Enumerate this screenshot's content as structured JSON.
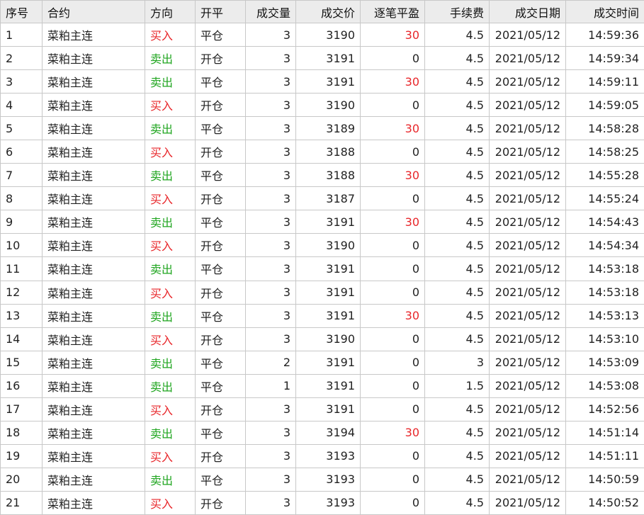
{
  "columns": [
    "序号",
    "合约",
    "方向",
    "开平",
    "成交量",
    "成交价",
    "逐笔平盈",
    "手续费",
    "成交日期",
    "成交时间"
  ],
  "colors": {
    "buy": "#e8262a",
    "sell": "#1fa51f",
    "profit": "#e8262a",
    "text": "#222222",
    "header_bg": "#ececec",
    "grid_line": "#c8c8c8"
  },
  "rows": [
    {
      "no": "1",
      "contract": "菜粕主连",
      "dir": "买入",
      "oc": "平仓",
      "vol": "3",
      "price": "3190",
      "pnl": "30",
      "fee": "4.5",
      "date": "2021/05/12",
      "time": "14:59:36"
    },
    {
      "no": "2",
      "contract": "菜粕主连",
      "dir": "卖出",
      "oc": "开仓",
      "vol": "3",
      "price": "3191",
      "pnl": "0",
      "fee": "4.5",
      "date": "2021/05/12",
      "time": "14:59:34"
    },
    {
      "no": "3",
      "contract": "菜粕主连",
      "dir": "卖出",
      "oc": "平仓",
      "vol": "3",
      "price": "3191",
      "pnl": "30",
      "fee": "4.5",
      "date": "2021/05/12",
      "time": "14:59:11"
    },
    {
      "no": "4",
      "contract": "菜粕主连",
      "dir": "买入",
      "oc": "开仓",
      "vol": "3",
      "price": "3190",
      "pnl": "0",
      "fee": "4.5",
      "date": "2021/05/12",
      "time": "14:59:05"
    },
    {
      "no": "5",
      "contract": "菜粕主连",
      "dir": "卖出",
      "oc": "平仓",
      "vol": "3",
      "price": "3189",
      "pnl": "30",
      "fee": "4.5",
      "date": "2021/05/12",
      "time": "14:58:28"
    },
    {
      "no": "6",
      "contract": "菜粕主连",
      "dir": "买入",
      "oc": "开仓",
      "vol": "3",
      "price": "3188",
      "pnl": "0",
      "fee": "4.5",
      "date": "2021/05/12",
      "time": "14:58:25"
    },
    {
      "no": "7",
      "contract": "菜粕主连",
      "dir": "卖出",
      "oc": "平仓",
      "vol": "3",
      "price": "3188",
      "pnl": "30",
      "fee": "4.5",
      "date": "2021/05/12",
      "time": "14:55:28"
    },
    {
      "no": "8",
      "contract": "菜粕主连",
      "dir": "买入",
      "oc": "开仓",
      "vol": "3",
      "price": "3187",
      "pnl": "0",
      "fee": "4.5",
      "date": "2021/05/12",
      "time": "14:55:24"
    },
    {
      "no": "9",
      "contract": "菜粕主连",
      "dir": "卖出",
      "oc": "平仓",
      "vol": "3",
      "price": "3191",
      "pnl": "30",
      "fee": "4.5",
      "date": "2021/05/12",
      "time": "14:54:43"
    },
    {
      "no": "10",
      "contract": "菜粕主连",
      "dir": "买入",
      "oc": "开仓",
      "vol": "3",
      "price": "3190",
      "pnl": "0",
      "fee": "4.5",
      "date": "2021/05/12",
      "time": "14:54:34"
    },
    {
      "no": "11",
      "contract": "菜粕主连",
      "dir": "卖出",
      "oc": "平仓",
      "vol": "3",
      "price": "3191",
      "pnl": "0",
      "fee": "4.5",
      "date": "2021/05/12",
      "time": "14:53:18"
    },
    {
      "no": "12",
      "contract": "菜粕主连",
      "dir": "买入",
      "oc": "开仓",
      "vol": "3",
      "price": "3191",
      "pnl": "0",
      "fee": "4.5",
      "date": "2021/05/12",
      "time": "14:53:18"
    },
    {
      "no": "13",
      "contract": "菜粕主连",
      "dir": "卖出",
      "oc": "平仓",
      "vol": "3",
      "price": "3191",
      "pnl": "30",
      "fee": "4.5",
      "date": "2021/05/12",
      "time": "14:53:13"
    },
    {
      "no": "14",
      "contract": "菜粕主连",
      "dir": "买入",
      "oc": "开仓",
      "vol": "3",
      "price": "3190",
      "pnl": "0",
      "fee": "4.5",
      "date": "2021/05/12",
      "time": "14:53:10"
    },
    {
      "no": "15",
      "contract": "菜粕主连",
      "dir": "卖出",
      "oc": "平仓",
      "vol": "2",
      "price": "3191",
      "pnl": "0",
      "fee": "3",
      "date": "2021/05/12",
      "time": "14:53:09"
    },
    {
      "no": "16",
      "contract": "菜粕主连",
      "dir": "卖出",
      "oc": "平仓",
      "vol": "1",
      "price": "3191",
      "pnl": "0",
      "fee": "1.5",
      "date": "2021/05/12",
      "time": "14:53:08"
    },
    {
      "no": "17",
      "contract": "菜粕主连",
      "dir": "买入",
      "oc": "开仓",
      "vol": "3",
      "price": "3191",
      "pnl": "0",
      "fee": "4.5",
      "date": "2021/05/12",
      "time": "14:52:56"
    },
    {
      "no": "18",
      "contract": "菜粕主连",
      "dir": "卖出",
      "oc": "平仓",
      "vol": "3",
      "price": "3194",
      "pnl": "30",
      "fee": "4.5",
      "date": "2021/05/12",
      "time": "14:51:14"
    },
    {
      "no": "19",
      "contract": "菜粕主连",
      "dir": "买入",
      "oc": "开仓",
      "vol": "3",
      "price": "3193",
      "pnl": "0",
      "fee": "4.5",
      "date": "2021/05/12",
      "time": "14:51:11"
    },
    {
      "no": "20",
      "contract": "菜粕主连",
      "dir": "卖出",
      "oc": "平仓",
      "vol": "3",
      "price": "3193",
      "pnl": "0",
      "fee": "4.5",
      "date": "2021/05/12",
      "time": "14:50:59"
    },
    {
      "no": "21",
      "contract": "菜粕主连",
      "dir": "买入",
      "oc": "开仓",
      "vol": "3",
      "price": "3193",
      "pnl": "0",
      "fee": "4.5",
      "date": "2021/05/12",
      "time": "14:50:52"
    }
  ]
}
